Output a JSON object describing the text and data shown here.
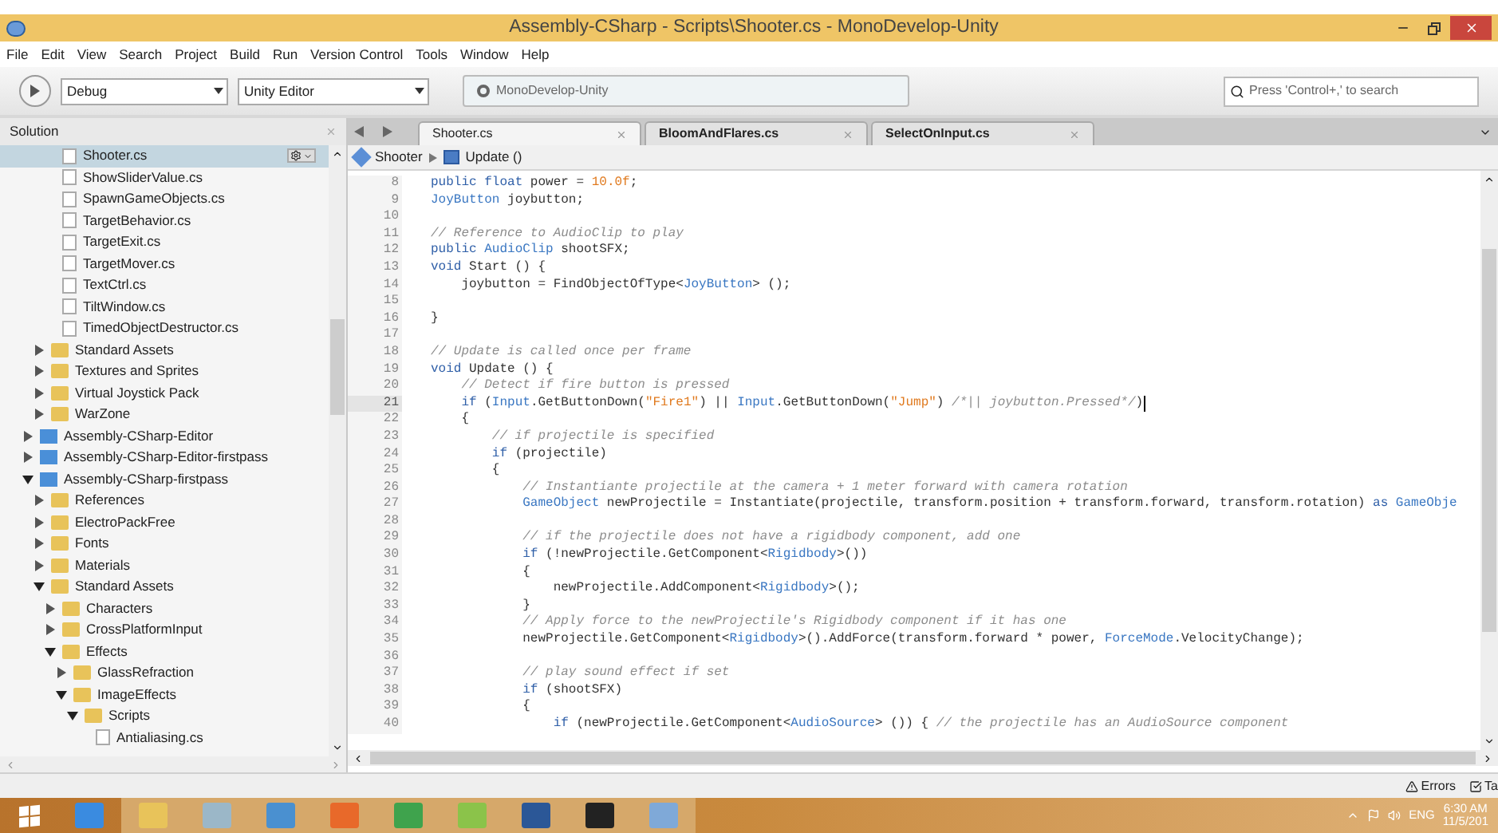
{
  "window": {
    "title": "Assembly-CSharp - Scripts\\Shooter.cs - MonoDevelop-Unity"
  },
  "menu": [
    "File",
    "Edit",
    "View",
    "Search",
    "Project",
    "Build",
    "Run",
    "Version Control",
    "Tools",
    "Window",
    "Help"
  ],
  "toolbar": {
    "configuration": "Debug",
    "target": "Unity Editor",
    "status": "MonoDevelop-Unity",
    "search": {
      "placeholder": "Press 'Control+,' to search"
    }
  },
  "solution": {
    "title": "Solution",
    "tree": [
      {
        "children": [
          {
            "children": [
              {
                "kind": "file",
                "label": "Shooter.cs",
                "selected": true
              },
              {
                "kind": "file",
                "label": "ShowSliderValue.cs",
                "selected": false
              },
              {
                "kind": "file",
                "label": "SpawnGameObjects.cs",
                "selected": false
              },
              {
                "kind": "file",
                "label": "TargetBehavior.cs",
                "selected": false
              },
              {
                "kind": "file",
                "label": "TargetExit.cs",
                "selected": false
              },
              {
                "kind": "file",
                "label": "TargetMover.cs",
                "selected": false
              },
              {
                "kind": "file",
                "label": "TextCtrl.cs",
                "selected": false
              },
              {
                "kind": "file",
                "label": "TiltWindow.cs",
                "selected": false
              },
              {
                "kind": "file",
                "label": "TimedObjectDestructor.cs",
                "selected": false
              }
            ]
          },
          {
            "kind": "folder",
            "label": "Standard Assets",
            "expanded": false,
            "selected": false
          },
          {
            "kind": "folder",
            "label": "Textures and Sprites",
            "expanded": false,
            "selected": false
          },
          {
            "kind": "folder",
            "label": "Virtual Joystick Pack",
            "expanded": false,
            "selected": false
          },
          {
            "kind": "folder",
            "label": "WarZone",
            "expanded": false,
            "selected": false
          }
        ]
      },
      {
        "kind": "project",
        "label": "Assembly-CSharp-Editor",
        "expanded": false,
        "selected": false
      },
      {
        "kind": "project",
        "label": "Assembly-CSharp-Editor-firstpass",
        "expanded": false,
        "selected": false
      },
      {
        "kind": "project",
        "label": "Assembly-CSharp-firstpass",
        "expanded": true,
        "selected": false,
        "children": [
          {
            "kind": "folder",
            "label": "References",
            "expanded": false,
            "selected": false
          },
          {
            "kind": "folder",
            "label": "ElectroPackFree",
            "expanded": false,
            "selected": false
          },
          {
            "kind": "folder",
            "label": "Fonts",
            "expanded": false,
            "selected": false
          },
          {
            "kind": "folder",
            "label": "Materials",
            "expanded": false,
            "selected": false
          },
          {
            "kind": "folder",
            "label": "Standard Assets",
            "expanded": true,
            "selected": false,
            "children": [
              {
                "kind": "folder",
                "label": "Characters",
                "expanded": false,
                "selected": false
              },
              {
                "kind": "folder",
                "label": "CrossPlatformInput",
                "expanded": false,
                "selected": false
              },
              {
                "kind": "folder",
                "label": "Effects",
                "expanded": true,
                "selected": false,
                "children": [
                  {
                    "kind": "folder",
                    "label": "GlassRefraction",
                    "expanded": false,
                    "selected": false
                  },
                  {
                    "kind": "folder",
                    "label": "ImageEffects",
                    "expanded": true,
                    "selected": false,
                    "children": [
                      {
                        "kind": "folder",
                        "label": "Scripts",
                        "expanded": true,
                        "selected": false,
                        "children": [
                          {
                            "kind": "file",
                            "label": "Antialiasing.cs",
                            "selected": false
                          }
                        ]
                      }
                    ]
                  }
                ]
              }
            ]
          }
        ]
      }
    ]
  },
  "tabs": [
    {
      "label": "Shooter.cs",
      "selected": true
    },
    {
      "label": "BloomAndFlares.cs",
      "selected": false
    },
    {
      "label": "SelectOnInput.cs",
      "selected": false
    }
  ],
  "breadcrumb": {
    "class": "Shooter",
    "method": "Update ()"
  },
  "code": [
    {
      "number": "8",
      "current": false,
      "tokens": [
        {
          "kind": "kw",
          "text": "public"
        },
        {
          "kind": "kw",
          "text": " float"
        },
        {
          "kind": "plain",
          "text": " power = "
        },
        {
          "kind": "num",
          "text": "10.0f"
        },
        {
          "kind": "plain",
          "text": ";"
        }
      ]
    },
    {
      "number": "9",
      "current": false,
      "tokens": [
        {
          "kind": "type",
          "text": "JoyButton"
        },
        {
          "kind": "plain",
          "text": " joybutton;"
        }
      ]
    },
    {
      "number": "10",
      "current": false
    },
    {
      "number": "11",
      "current": false,
      "tokens": [
        {
          "kind": "comment",
          "text": "// Reference to AudioClip to play"
        }
      ]
    },
    {
      "number": "12",
      "current": false,
      "tokens": [
        {
          "kind": "kw",
          "text": "public"
        },
        {
          "kind": "type",
          "text": " AudioClip"
        },
        {
          "kind": "plain",
          "text": " shootSFX;"
        }
      ]
    },
    {
      "number": "13",
      "current": false,
      "tokens": [
        {
          "kind": "kw",
          "text": "void"
        },
        {
          "kind": "plain",
          "text": " Start () {"
        }
      ]
    },
    {
      "number": "14",
      "current": false,
      "tokens": [
        {
          "kind": "plain",
          "text": "    joybutton = FindObjectOfType<"
        },
        {
          "kind": "type",
          "text": "JoyButton"
        },
        {
          "kind": "plain",
          "text": "> ();"
        }
      ]
    },
    {
      "number": "15",
      "current": false
    },
    {
      "number": "16",
      "current": false,
      "tokens": [
        {
          "kind": "plain",
          "text": "}"
        }
      ]
    },
    {
      "number": "17",
      "current": false
    },
    {
      "number": "18",
      "current": false,
      "tokens": [
        {
          "kind": "comment",
          "text": "// Update is called once per frame"
        }
      ]
    },
    {
      "number": "19",
      "current": false,
      "tokens": [
        {
          "kind": "kw",
          "text": "void"
        },
        {
          "kind": "plain",
          "text": " Update () {"
        }
      ]
    },
    {
      "number": "20",
      "current": false,
      "tokens": [
        {
          "kind": "comment",
          "text": "    // Detect if fire button is pressed"
        }
      ]
    },
    {
      "number": "21",
      "current": true,
      "tokens": [
        {
          "kind": "kw",
          "text": "    if"
        },
        {
          "kind": "plain",
          "text": " ("
        },
        {
          "kind": "type",
          "text": "Input"
        },
        {
          "kind": "plain",
          "text": ".GetButtonDown("
        },
        {
          "kind": "str",
          "text": "\"Fire1\""
        },
        {
          "kind": "plain",
          "text": ") || "
        },
        {
          "kind": "type",
          "text": "Input"
        },
        {
          "kind": "plain",
          "text": ".GetButtonDown("
        },
        {
          "kind": "str",
          "text": "\"Jump\""
        },
        {
          "kind": "plain",
          "text": ") "
        },
        {
          "kind": "comment",
          "text": "/*|| joybutton.Pressed*/"
        },
        {
          "kind": "plain",
          "text": ")"
        }
      ]
    },
    {
      "number": "22",
      "current": false,
      "tokens": [
        {
          "kind": "plain",
          "text": "    {"
        }
      ]
    },
    {
      "number": "23",
      "current": false,
      "tokens": [
        {
          "kind": "comment",
          "text": "        // if projectile is specified"
        }
      ]
    },
    {
      "number": "24",
      "current": false,
      "tokens": [
        {
          "kind": "kw",
          "text": "        if"
        },
        {
          "kind": "plain",
          "text": " (projectile)"
        }
      ]
    },
    {
      "number": "25",
      "current": false,
      "tokens": [
        {
          "kind": "plain",
          "text": "        {"
        }
      ]
    },
    {
      "number": "26",
      "current": false,
      "tokens": [
        {
          "kind": "comment",
          "text": "            // Instantiante projectile at the camera + 1 meter forward with camera rotation"
        }
      ]
    },
    {
      "number": "27",
      "current": false,
      "tokens": [
        {
          "kind": "type",
          "text": "            GameObject"
        },
        {
          "kind": "plain",
          "text": " newProjectile = Instantiate(projectile, transform.position + transform.forward, transform.rotation) "
        },
        {
          "kind": "kw",
          "text": "as"
        },
        {
          "kind": "type",
          "text": " GameObje"
        }
      ]
    },
    {
      "number": "28",
      "current": false
    },
    {
      "number": "29",
      "current": false,
      "tokens": [
        {
          "kind": "comment",
          "text": "            // if the projectile does not have a rigidbody component, add one"
        }
      ]
    },
    {
      "number": "30",
      "current": false,
      "tokens": [
        {
          "kind": "kw",
          "text": "            if"
        },
        {
          "kind": "plain",
          "text": " (!newProjectile.GetComponent<"
        },
        {
          "kind": "type",
          "text": "Rigidbody"
        },
        {
          "kind": "plain",
          "text": ">())"
        }
      ]
    },
    {
      "number": "31",
      "current": false,
      "tokens": [
        {
          "kind": "plain",
          "text": "            {"
        }
      ]
    },
    {
      "number": "32",
      "current": false,
      "tokens": [
        {
          "kind": "plain",
          "text": "                newProjectile.AddComponent<"
        },
        {
          "kind": "type",
          "text": "Rigidbody"
        },
        {
          "kind": "plain",
          "text": ">();"
        }
      ]
    },
    {
      "number": "33",
      "current": false,
      "tokens": [
        {
          "kind": "plain",
          "text": "            }"
        }
      ]
    },
    {
      "number": "34",
      "current": false,
      "tokens": [
        {
          "kind": "comment",
          "text": "            // Apply force to the newProjectile's Rigidbody component if it has one"
        }
      ]
    },
    {
      "number": "35",
      "current": false,
      "tokens": [
        {
          "kind": "plain",
          "text": "            newProjectile.GetComponent<"
        },
        {
          "kind": "type",
          "text": "Rigidbody"
        },
        {
          "kind": "plain",
          "text": ">().AddForce(transform.forward * power, "
        },
        {
          "kind": "type",
          "text": "ForceMode"
        },
        {
          "kind": "plain",
          "text": ".VelocityChange);"
        }
      ]
    },
    {
      "number": "36",
      "current": false
    },
    {
      "number": "37",
      "current": false,
      "tokens": [
        {
          "kind": "comment",
          "text": "            // play sound effect if set"
        }
      ]
    },
    {
      "number": "38",
      "current": false,
      "tokens": [
        {
          "kind": "kw",
          "text": "            if"
        },
        {
          "kind": "plain",
          "text": " (shootSFX)"
        }
      ]
    },
    {
      "number": "39",
      "current": false,
      "tokens": [
        {
          "kind": "plain",
          "text": "            {"
        }
      ]
    },
    {
      "number": "40",
      "current": false,
      "tokens": [
        {
          "kind": "kw",
          "text": "                if"
        },
        {
          "kind": "plain",
          "text": " (newProjectile.GetComponent<"
        },
        {
          "kind": "type",
          "text": "AudioSource"
        },
        {
          "kind": "plain",
          "text": "> ()) { "
        },
        {
          "kind": "comment",
          "text": "// the projectile has an AudioSource component"
        }
      ]
    }
  ],
  "status_bar": [
    {
      "kind": "errors",
      "label": "Errors"
    },
    {
      "kind": "tasks",
      "label": "Ta"
    }
  ],
  "taskbar": {
    "language": "ENG",
    "time": "6:30 AM",
    "date": "11/5/201"
  }
}
